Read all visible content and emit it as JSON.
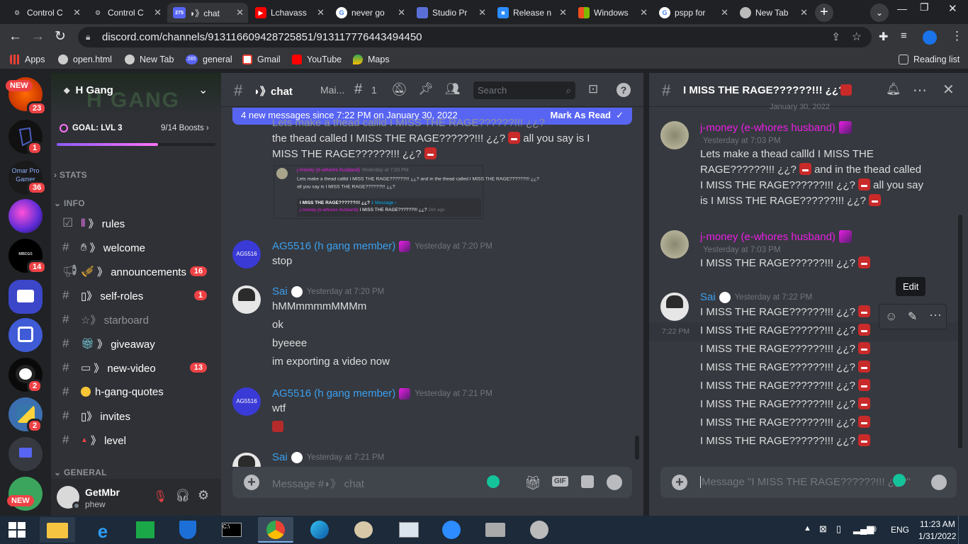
{
  "browser": {
    "tabs": [
      {
        "title": "Control C",
        "icon": "gear-icon"
      },
      {
        "title": "Control C",
        "icon": "gear-icon"
      },
      {
        "title": "◗》chat",
        "icon": "discord-icon",
        "badge": "275"
      },
      {
        "title": "Lchavass",
        "icon": "youtube-icon"
      },
      {
        "title": "never go",
        "icon": "google-icon"
      },
      {
        "title": "Studio Pr",
        "icon": "studio-icon"
      },
      {
        "title": "Release n",
        "icon": "zoom-icon"
      },
      {
        "title": "Windows",
        "icon": "windows-icon"
      },
      {
        "title": "pspp for",
        "icon": "google-icon"
      },
      {
        "title": "New Tab",
        "icon": "chrome-icon"
      }
    ],
    "url": "discord.com/channels/913116609428725851/913117776443494450",
    "bookmarks": [
      {
        "label": "Apps"
      },
      {
        "label": "open.html"
      },
      {
        "label": "New Tab"
      },
      {
        "label": "general",
        "badge": "285"
      },
      {
        "label": "Gmail"
      },
      {
        "label": "YouTube"
      },
      {
        "label": "Maps"
      }
    ],
    "reading_list": "Reading list"
  },
  "guilds": [
    {
      "badge": "23",
      "new": "NEW"
    },
    {
      "badge": "1"
    },
    {
      "badge": "36",
      "label": "Omar Pro Gamer"
    },
    {
      "badge": ""
    },
    {
      "badge": "14"
    },
    {
      "badge": ""
    },
    {
      "badge": ""
    },
    {
      "badge": "2"
    },
    {
      "badge": "2"
    },
    {
      "badge": ""
    },
    {
      "badge": "",
      "new": "NEW"
    }
  ],
  "server": {
    "name": "H Gang",
    "goal": "GOAL: LVL 3",
    "boosts": "9/14 Boosts",
    "categories": {
      "stats": "STATS",
      "info": "INFO",
      "general": "GENERAL"
    },
    "channels": [
      {
        "name": "》 rules",
        "badge": ""
      },
      {
        "name": "》 welcome",
        "badge": ""
      },
      {
        "name": "》 announcements",
        "badge": "16"
      },
      {
        "name": "▯》 self-roles",
        "badge": "1"
      },
      {
        "name": "☆》 starboard",
        "badge": ""
      },
      {
        "name": "》 giveaway",
        "badge": ""
      },
      {
        "name": "》 new-video",
        "badge": "13"
      },
      {
        "name": "h-gang-quotes",
        "badge": ""
      },
      {
        "name": "▯》 invites",
        "badge": ""
      },
      {
        "name": "》 level",
        "badge": ""
      }
    ]
  },
  "user": {
    "name": "GetMbr",
    "status": "phew"
  },
  "chat": {
    "channel_title": "◗》chat",
    "header_tabs": [
      "Mai...",
      "1"
    ],
    "search_placeholder": "Search",
    "new_banner": "4 new messages since 7:22 PM on January 30, 2022",
    "mark_read": "Mark As Read",
    "partial_lines": [
      "Lets make a thead callld I MISS THE RAGE??????!!! ¿¿?",
      "the thead called I MISS THE RAGE??????!!! ¿¿?",
      "all you say is I",
      "MISS THE RAGE??????!!! ¿¿?"
    ],
    "embed": {
      "user": "j-money (e-whores husband)",
      "time": "Yesterday at 7:03 PM",
      "text": "Lets make a thead callld I MISS THE RAGE??????!!! ¿¿? and in the thead called I MISS THE RAGE??????!!! ¿¿? all you say is I MISS THE RAGE??????!!! ¿¿?",
      "thread_title": "I MISS THE RAGE??????!!! ¿¿?",
      "thread_count": "1 Message ›",
      "thread_preview_user": "j-money (e-whores husband)",
      "thread_preview_text": "I MISS THE RAGE??????!!! ¿¿?",
      "thread_preview_time": "16h ago"
    },
    "messages": [
      {
        "user": "AG5516 (h gang member)",
        "avatar_text": "AG5516",
        "time": "Yesterday at 7:20 PM",
        "lines": [
          "stop"
        ]
      },
      {
        "user": "Sai",
        "time": "Yesterday at 7:20 PM",
        "lines": [
          "hMMmmmmMMMm",
          "ok",
          "byeeee",
          "im exporting a video now"
        ]
      },
      {
        "user": "AG5516 (h gang member)",
        "avatar_text": "AG5516",
        "time": "Yesterday at 7:21 PM",
        "lines": [
          "wtf"
        ]
      },
      {
        "user": "Sai",
        "time": "Yesterday at 7:21 PM",
        "lines": []
      }
    ],
    "input_placeholder": "Message #◗》 chat"
  },
  "thread": {
    "title": "I MISS THE RAGE??????!!! ¿¿?",
    "date_divider": "January 30, 2022",
    "messages": [
      {
        "user": "j-money (e-whores husband)",
        "time": "Yesterday at 7:03 PM",
        "lines": [
          "Lets make a thead callld I MISS THE",
          "RAGE??????!!! ¿¿?",
          "and in the thead called",
          "I MISS THE RAGE??????!!! ¿¿?",
          "all you say",
          "is I MISS THE RAGE??????!!! ¿¿?"
        ]
      },
      {
        "user": "j-money (e-whores husband)",
        "time": "Yesterday at 7:03 PM",
        "lines": [
          "I MISS THE RAGE??????!!! ¿¿?"
        ]
      },
      {
        "user": "Sai",
        "time": "Yesterday at 7:22 PM",
        "lines": [
          "I MISS THE RAGE??????!!! ¿¿?",
          "I MISS THE RAGE??????!!! ¿¿?",
          "I MISS THE RAGE??????!!! ¿¿?",
          "I MISS THE RAGE??????!!! ¿¿?",
          "I MISS THE RAGE??????!!! ¿¿?",
          "I MISS THE RAGE??????!!! ¿¿?",
          "I MISS THE RAGE??????!!! ¿¿?",
          "I MISS THE RAGE??????!!! ¿¿?"
        ]
      }
    ],
    "hover_time": "7:22 PM",
    "tooltip": "Edit",
    "input_placeholder": "Message \"I MISS THE RAGE??????!!! ¿¿?\""
  },
  "taskbar": {
    "lang": "ENG",
    "time": "11:23 AM",
    "date": "1/31/2022"
  },
  "colors": {
    "accent": "#5865f2",
    "pink_user": "#e91ee5",
    "blue_user": "#3ba0f0",
    "badge": "#ed4245"
  }
}
